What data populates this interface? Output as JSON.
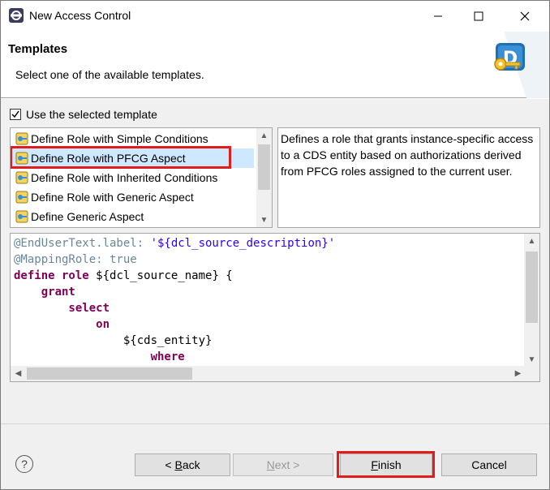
{
  "window": {
    "title": "New Access Control",
    "minimize_label": "Minimize",
    "maximize_label": "Maximize",
    "close_label": "Close"
  },
  "header": {
    "title": "Templates",
    "description": "Select one of the available templates."
  },
  "use_template": {
    "label": "Use the selected template",
    "checked": true
  },
  "templates": {
    "items": [
      {
        "label": "Define Role with Simple Conditions",
        "selected": false
      },
      {
        "label": "Define Role with PFCG Aspect",
        "selected": true
      },
      {
        "label": "Define Role with Inherited Conditions",
        "selected": false
      },
      {
        "label": "Define Role with Generic Aspect",
        "selected": false
      },
      {
        "label": "Define Generic Aspect",
        "selected": false
      }
    ],
    "highlight_color": "#e21b1b"
  },
  "description": {
    "text": "Defines a role that grants instance-specific access to a CDS entity based on authorizations derived from PFCG roles assigned to the current user."
  },
  "code": {
    "lines": [
      {
        "parts": [
          {
            "t": "@EndUserText.label: ",
            "c": "ann"
          },
          {
            "t": "'${dcl_source_description}'",
            "c": "str"
          }
        ]
      },
      {
        "parts": [
          {
            "t": "@MappingRole: true",
            "c": "ann"
          }
        ]
      },
      {
        "parts": [
          {
            "t": "define role ",
            "c": "kw"
          },
          {
            "t": "${dcl_source_name} {",
            "c": "def"
          }
        ]
      },
      {
        "parts": [
          {
            "t": "    grant",
            "c": "kw"
          }
        ]
      },
      {
        "parts": [
          {
            "t": "        select",
            "c": "kw"
          }
        ]
      },
      {
        "parts": [
          {
            "t": "            on",
            "c": "kw"
          }
        ]
      },
      {
        "parts": [
          {
            "t": "                ${cds_entity}",
            "c": "def"
          }
        ]
      },
      {
        "parts": [
          {
            "t": "                    where",
            "c": "kw"
          }
        ]
      }
    ]
  },
  "footer": {
    "help_symbol": "?",
    "back_label": "< Back",
    "back_mnemonic": "B",
    "next_label": "Next >",
    "next_mnemonic": "N",
    "finish_label": "Finish",
    "finish_mnemonic": "F",
    "cancel_label": "Cancel",
    "next_enabled": false
  },
  "colors": {
    "accent_highlight": "#e21b1b",
    "selection_bg": "#cde8ff",
    "keyword": "#7f0055",
    "annotation": "#6a8696",
    "string": "#2a00ff"
  }
}
